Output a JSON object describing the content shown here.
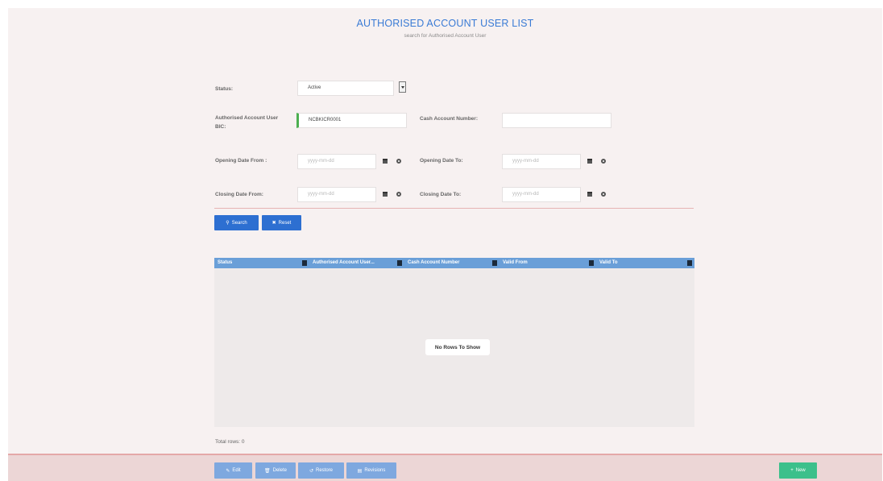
{
  "header": {
    "title": "AUTHORISED ACCOUNT USER LIST",
    "subtitle": "search for Authorised Account User"
  },
  "form": {
    "status_label": "Status:",
    "status_value": "Active",
    "bic_label": "Authorised Account User BIC:",
    "bic_value": "NCBKICR0001",
    "cash_account_label": "Cash Account Number:",
    "cash_account_value": "",
    "opening_from_label": "Opening Date From :",
    "opening_to_label": "Opening Date To:",
    "closing_from_label": "Closing Date From:",
    "closing_to_label": "Closing Date To:",
    "date_placeholder": "yyyy-mm-dd"
  },
  "actions": {
    "search_label": "Search",
    "reset_label": "Reset"
  },
  "grid": {
    "columns": [
      "Status",
      "Authorised Account User...",
      "Cash Account Number",
      "Valid From",
      "Valid To"
    ],
    "empty_message": "No Rows To Show",
    "total_rows": "Total rows: 0"
  },
  "footer": {
    "edit_label": "Edit",
    "delete_label": "Delete",
    "restore_label": "Restore",
    "revisions_label": "Revisions",
    "new_label": "New"
  },
  "colors": {
    "primary": "#2d6fd1",
    "header_blue": "#6a9fd8",
    "new_green": "#3cc08b",
    "divider_red": "#e6b4b4"
  }
}
